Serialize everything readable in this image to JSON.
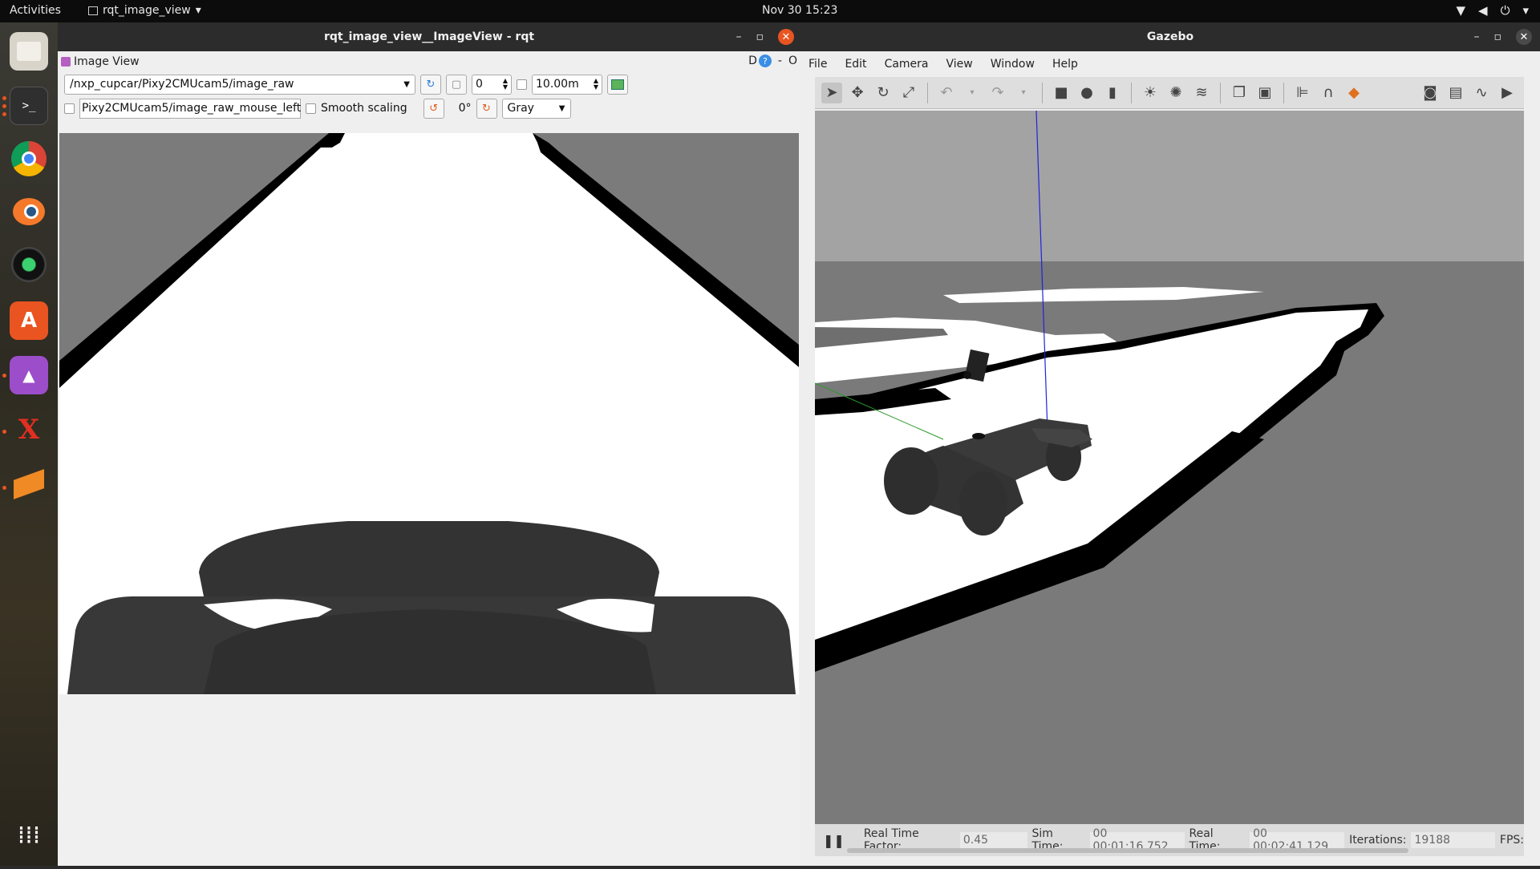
{
  "topbar": {
    "activities": "Activities",
    "app_name": "rqt_image_view",
    "clock": "Nov 30  15:23"
  },
  "dock": {
    "items": [
      "files-icon",
      "terminal-icon",
      "chrome-icon",
      "blender-icon",
      "camera-icon",
      "software-icon",
      "image-viewer-icon",
      "xacro-icon",
      "layers-icon",
      "apps-grid-icon"
    ]
  },
  "rqt": {
    "title": "rqt_image_view__ImageView - rqt",
    "plugin_title": "Image View",
    "plugin_ctrl_d": "D",
    "plugin_ctrl_help": "?",
    "plugin_ctrl_min": "-",
    "plugin_ctrl_o": "O",
    "topic": "/nxp_cupcar/Pixy2CMUcam5/image_raw",
    "spin_value": "0",
    "time_value": "10.00m",
    "mouse_topic": "Pixy2CMUcam5/image_raw_mouse_left",
    "smooth_scaling": "Smooth scaling",
    "rotation": "0°",
    "colormap": "Gray"
  },
  "gazebo": {
    "title": "Gazebo",
    "menu": [
      "File",
      "Edit",
      "Camera",
      "View",
      "Window",
      "Help"
    ],
    "status": {
      "rtf_label": "Real Time Factor:",
      "rtf_value": "0.45",
      "sim_label": "Sim Time:",
      "sim_value": "00 00:01:16.752",
      "real_label": "Real Time:",
      "real_value": "00 00:02:41.129",
      "iter_label": "Iterations:",
      "iter_value": "19188",
      "fps_label": "FPS:"
    }
  },
  "colors": {
    "accent": "#e95420",
    "track_white": "#ffffff",
    "ground_grey": "#7a7a7a",
    "car_dark": "#333333"
  }
}
